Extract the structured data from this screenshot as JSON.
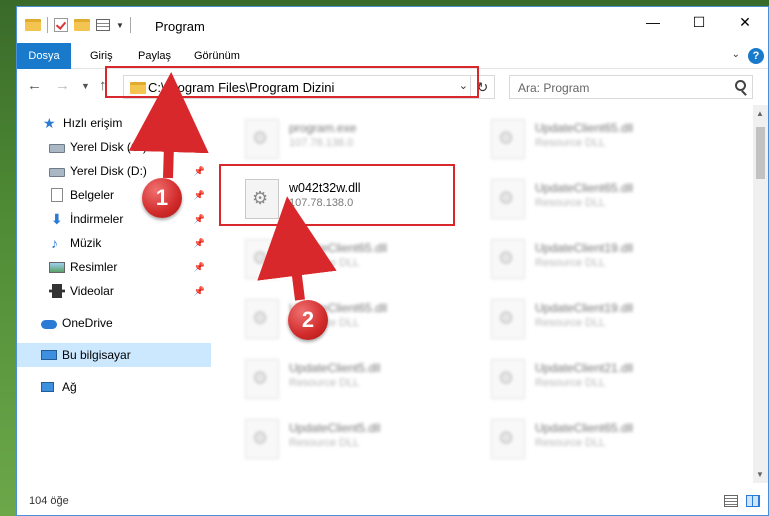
{
  "window": {
    "title": "Program",
    "controls": {
      "minimize": "—",
      "maximize": "☐",
      "close": "✕"
    }
  },
  "ribbon": {
    "tabs": [
      {
        "label": "Dosya"
      },
      {
        "label": "Giriş"
      },
      {
        "label": "Paylaş"
      },
      {
        "label": "Görünüm"
      }
    ],
    "help": "?"
  },
  "navbar": {
    "address": "C:\\Program Files\\Program Dizini",
    "search_placeholder": "Ara: Program"
  },
  "sidebar": {
    "items": [
      {
        "label": "Hızlı erişim",
        "icon": "star-icon",
        "pinned": false
      },
      {
        "label": "Yerel Disk (C:)",
        "icon": "drive-icon",
        "pinned": true
      },
      {
        "label": "Yerel Disk (D:)",
        "icon": "drive-icon",
        "pinned": true
      },
      {
        "label": "Belgeler",
        "icon": "documents-icon",
        "pinned": true
      },
      {
        "label": "İndirmeler",
        "icon": "downloads-icon",
        "pinned": true
      },
      {
        "label": "Müzik",
        "icon": "music-icon",
        "pinned": true
      },
      {
        "label": "Resimler",
        "icon": "pictures-icon",
        "pinned": true
      },
      {
        "label": "Videolar",
        "icon": "videos-icon",
        "pinned": true
      },
      {
        "label": "OneDrive",
        "icon": "cloud-icon",
        "pinned": false
      },
      {
        "label": "Bu bilgisayar",
        "icon": "computer-icon",
        "pinned": false,
        "selected": true
      },
      {
        "label": "Ağ",
        "icon": "network-icon",
        "pinned": false
      }
    ]
  },
  "files": [
    {
      "name": "program.exe",
      "desc": "107.78.138.0"
    },
    {
      "name": "UpdateClient65.dll",
      "desc": "Resource DLL"
    },
    {
      "name": "w042t32w.dll",
      "desc": "107.78.138.0"
    },
    {
      "name": "UpdateClient65.dll",
      "desc": "Resource DLL"
    },
    {
      "name": "UpdateClient65.dll",
      "desc": "Resource DLL"
    },
    {
      "name": "UpdateClient19.dll",
      "desc": "Resource DLL"
    },
    {
      "name": "UpdateClient65.dll",
      "desc": "Resource DLL"
    },
    {
      "name": "UpdateClient19.dll",
      "desc": "Resource DLL"
    },
    {
      "name": "UpdateClient5.dll",
      "desc": "Resource DLL"
    },
    {
      "name": "UpdateClient21.dll",
      "desc": "Resource DLL"
    },
    {
      "name": "UpdateClient5.dll",
      "desc": "Resource DLL"
    },
    {
      "name": "UpdateClient65.dll",
      "desc": "Resource DLL"
    }
  ],
  "status": {
    "count": "104 öğe"
  },
  "annotations": {
    "step1": "1",
    "step2": "2",
    "color": "#d9282c"
  }
}
